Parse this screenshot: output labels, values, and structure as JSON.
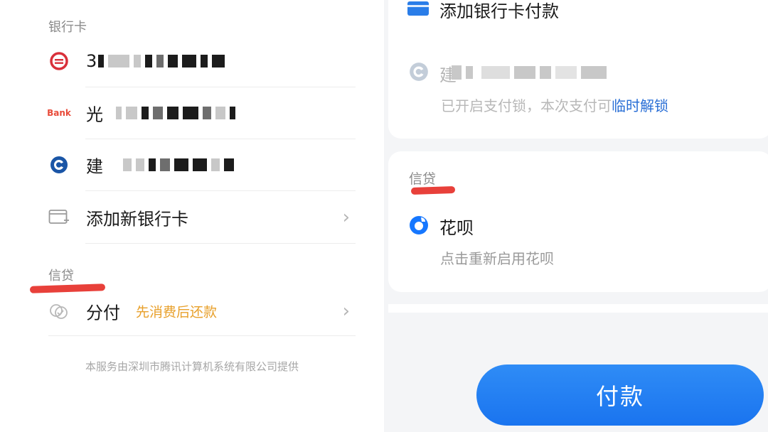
{
  "left": {
    "section_bank": "银行卡",
    "cards": [
      {
        "icon": "bank-red-icon",
        "name_prefix": "3",
        "color": "#d9303a"
      },
      {
        "icon": "bank-orange-icon",
        "name_prefix": "光",
        "badge": "Bank",
        "color": "#e84b3a"
      },
      {
        "icon": "ccb-icon",
        "name_prefix": "建",
        "color": "#1a55a6"
      }
    ],
    "add_card_label": "添加新银行卡",
    "section_credit": "信贷",
    "fenfu_label": "分付",
    "fenfu_sub": "先消费后还款",
    "footer": "本服务由深圳市腾讯计算机系统有限公司提供"
  },
  "right": {
    "add_card_pay": "添加银行卡付款",
    "ccb_prefix": "建",
    "lock_text": "已开启支付锁，本次支付可",
    "unlock_link": "临时解锁",
    "section_credit": "信贷",
    "huabei_label": "花呗",
    "huabei_sub": "点击重新启用花呗",
    "pay_button": "付款"
  },
  "colors": {
    "accent_blue": "#1a74ef",
    "link_blue": "#2a6fd6",
    "orange": "#e8a02b",
    "red_mark": "#e8403a"
  }
}
